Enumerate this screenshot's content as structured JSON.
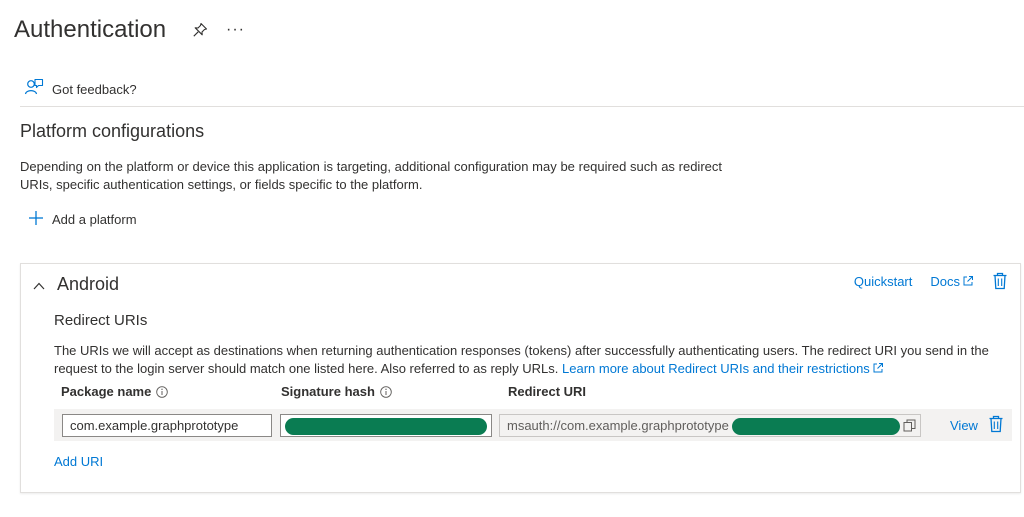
{
  "header": {
    "title": "Authentication",
    "more_label": "···"
  },
  "toolbar": {
    "feedback_label": "Got feedback?"
  },
  "platform_section": {
    "title": "Platform configurations",
    "description": "Depending on the platform or device this application is targeting, additional configuration may be required such as redirect URIs, specific authentication settings, or fields specific to the platform.",
    "add_platform_label": "Add a platform"
  },
  "android_card": {
    "title": "Android",
    "quickstart_label": "Quickstart",
    "docs_label": "Docs",
    "redirect_title": "Redirect URIs",
    "redirect_desc": "The URIs we will accept as destinations when returning authentication responses (tokens) after successfully authenticating users. The redirect URI you send in the request to the login server should match one listed here. Also referred to as reply URLs.",
    "learn_more_label": "Learn more about Redirect URIs and their restrictions",
    "columns": {
      "package_name": "Package name",
      "signature_hash": "Signature hash",
      "redirect_uri": "Redirect URI"
    },
    "row": {
      "package_name": "com.example.graphprototype",
      "redirect_uri_prefix": "msauth://com.example.graphprototype",
      "view_label": "View"
    },
    "add_uri_label": "Add URI"
  },
  "colors": {
    "accent": "#0078d4",
    "text": "#323130",
    "redaction": "#0a7c52",
    "row_bg": "#f3f2f1"
  }
}
